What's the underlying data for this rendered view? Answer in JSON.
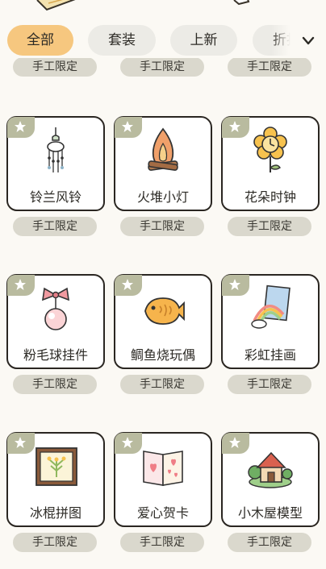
{
  "tabs": [
    {
      "label": "全部",
      "active": true
    },
    {
      "label": "套装",
      "active": false
    },
    {
      "label": "上新",
      "active": false
    },
    {
      "label": "折扣",
      "active": false
    }
  ],
  "colors": {
    "active_tab": "#f6c77f",
    "tab": "#ecebe6",
    "badge": "#dad8cd",
    "star_tab": "#b9bb9f"
  },
  "top_row_badges": [
    "手工限定",
    "手工限定",
    "手工限定"
  ],
  "items": [
    {
      "name": "铃兰风铃",
      "badge": "手工限定",
      "icon": "wind-chime-icon",
      "starred": true
    },
    {
      "name": "火堆小灯",
      "badge": "手工限定",
      "icon": "campfire-lamp-icon",
      "starred": true
    },
    {
      "name": "花朵时钟",
      "badge": "手工限定",
      "icon": "flower-clock-icon",
      "starred": true
    },
    {
      "name": "粉毛球挂件",
      "badge": "手工限定",
      "icon": "pink-pompom-icon",
      "starred": true
    },
    {
      "name": "鲷鱼烧玩偶",
      "badge": "手工限定",
      "icon": "taiyaki-icon",
      "starred": true
    },
    {
      "name": "彩虹挂画",
      "badge": "手工限定",
      "icon": "rainbow-painting-icon",
      "starred": true
    },
    {
      "name": "冰棍拼图",
      "badge": "手工限定",
      "icon": "popsicle-puzzle-icon",
      "starred": true
    },
    {
      "name": "爱心贺卡",
      "badge": "手工限定",
      "icon": "love-card-icon",
      "starred": true
    },
    {
      "name": "小木屋模型",
      "badge": "手工限定",
      "icon": "cabin-model-icon",
      "starred": true
    }
  ]
}
